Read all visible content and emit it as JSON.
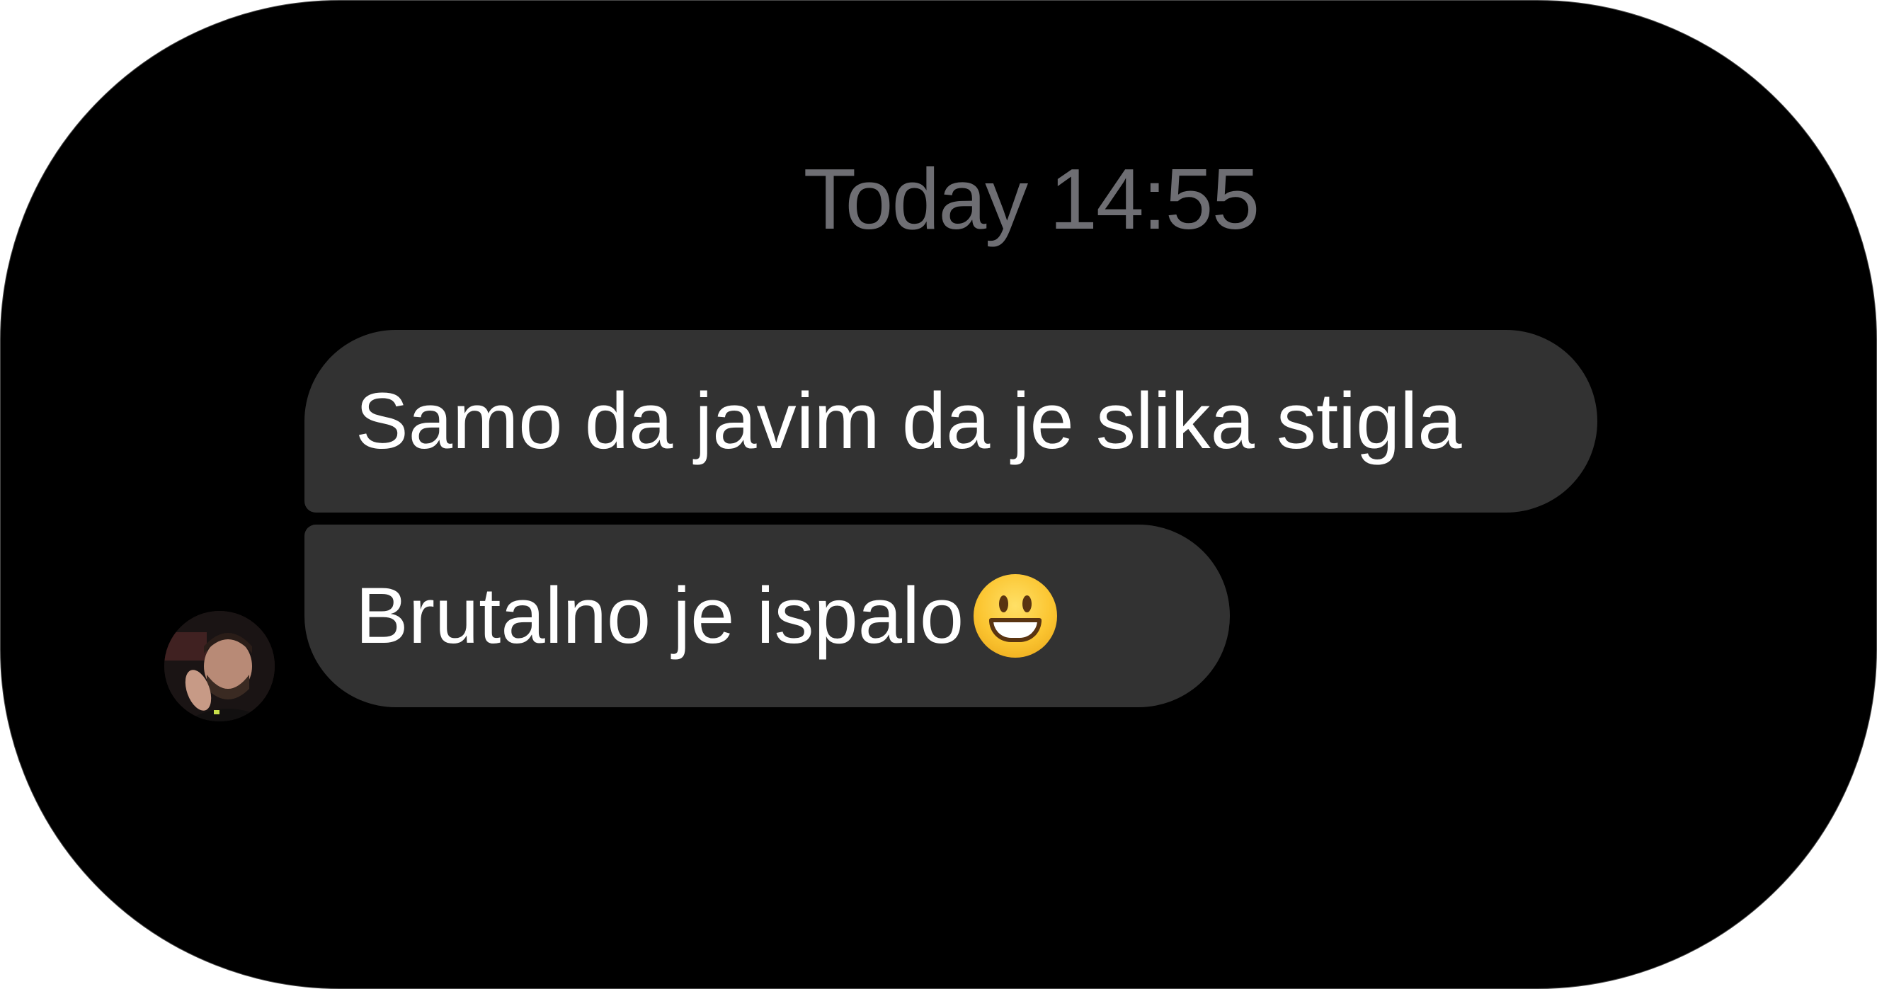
{
  "timestamp": "Today 14:55",
  "messages": [
    {
      "text": "Samo da javim da je slika stigla"
    },
    {
      "text": "Brutalno je ispalo",
      "emoji": "grinning-face-icon"
    }
  ],
  "colors": {
    "background": "#000000",
    "bubble": "#323232",
    "timestamp": "#6e6e73",
    "text": "#ffffff"
  }
}
